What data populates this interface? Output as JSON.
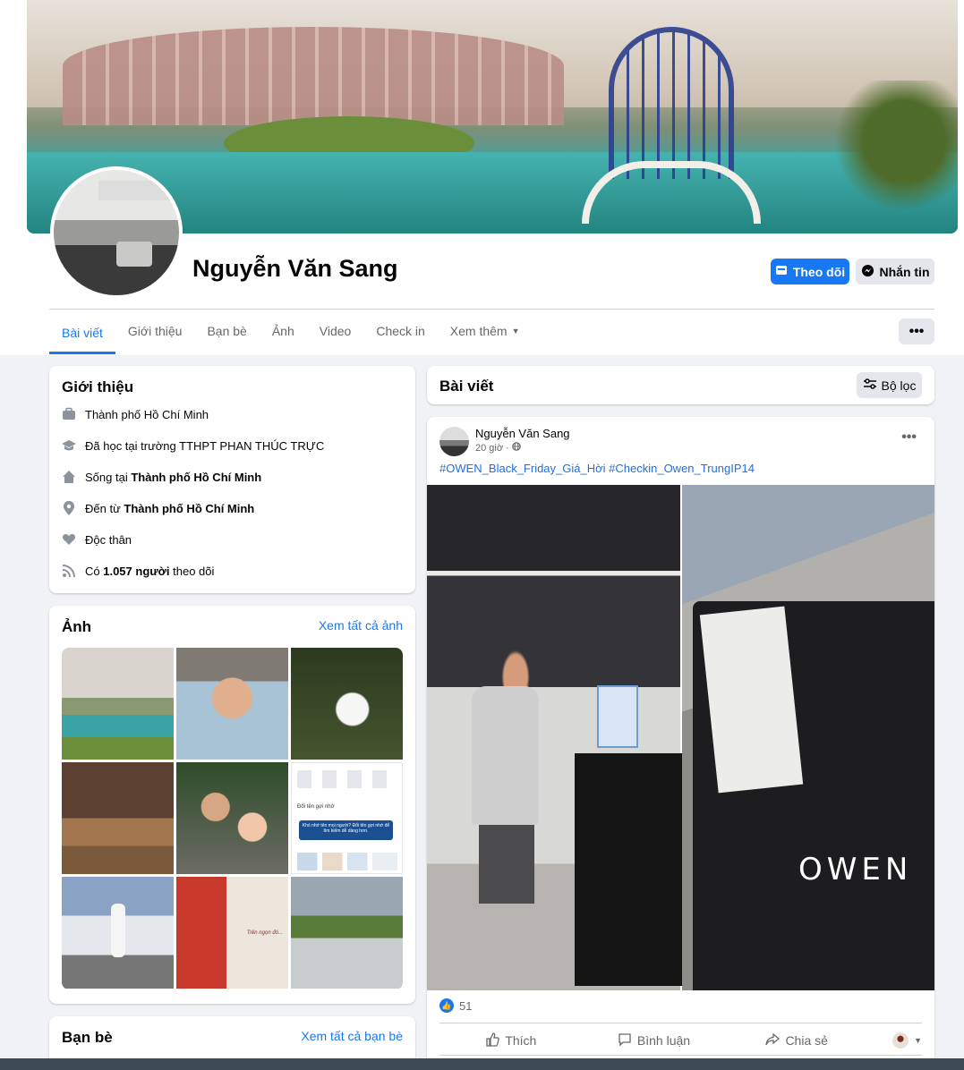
{
  "profile": {
    "name": "Nguyễn Văn Sang",
    "follow_label": "Theo dõi",
    "message_label": "Nhắn tin"
  },
  "tabs": [
    {
      "label": "Bài viết",
      "active": true
    },
    {
      "label": "Giới thiệu"
    },
    {
      "label": "Bạn bè"
    },
    {
      "label": "Ảnh"
    },
    {
      "label": "Video"
    },
    {
      "label": "Check in"
    },
    {
      "label": "Xem thêm"
    }
  ],
  "more_label": "•••",
  "intro": {
    "title": "Giới thiệu",
    "items": [
      {
        "icon": "briefcase-icon",
        "pre": "Thành phố Hồ Chí Minh",
        "bold": ""
      },
      {
        "icon": "graduation-cap-icon",
        "pre": "Đã học tại trường TTHPT PHAN THÚC TRỰC",
        "bold": ""
      },
      {
        "icon": "home-icon",
        "pre": "Sống tại ",
        "bold": "Thành phố Hồ Chí Minh"
      },
      {
        "icon": "location-pin-icon",
        "pre": "Đến từ ",
        "bold": "Thành phố Hồ Chí Minh"
      },
      {
        "icon": "heart-icon",
        "pre": "Độc thân",
        "bold": ""
      },
      {
        "icon": "rss-icon",
        "pre": "Có ",
        "bold": "1.057 người",
        "post": " theo dõi"
      }
    ]
  },
  "photos": {
    "title": "Ảnh",
    "see_all": "Xem tất cả ảnh",
    "thumb6": {
      "title": "Đổi tên gợi nhớ",
      "tip": "Khó nhớ tên mọi người? Đổi tên gợi nhớ để tìm kiếm dễ dàng hơn."
    },
    "thumb8_caption": "Trên ngọn đó..."
  },
  "friends": {
    "title": "Bạn bè",
    "see_all": "Xem tất cả bạn bè"
  },
  "posts_header": {
    "title": "Bài viết",
    "filter_label": "Bộ lọc"
  },
  "post": {
    "author": "Nguyễn Văn Sang",
    "time": "20 giờ ·",
    "tags": "#OWEN_Black_Friday_Giá_Hời #Checkin_Owen_TrungIP14",
    "brand_text": "OWEN",
    "likes": "51",
    "actions": {
      "like": "Thích",
      "comment": "Bình luận",
      "share": "Chia sẻ"
    }
  },
  "colors": {
    "accent": "#1877f2",
    "background": "#f0f2f5",
    "secondary_text": "#65676b"
  }
}
